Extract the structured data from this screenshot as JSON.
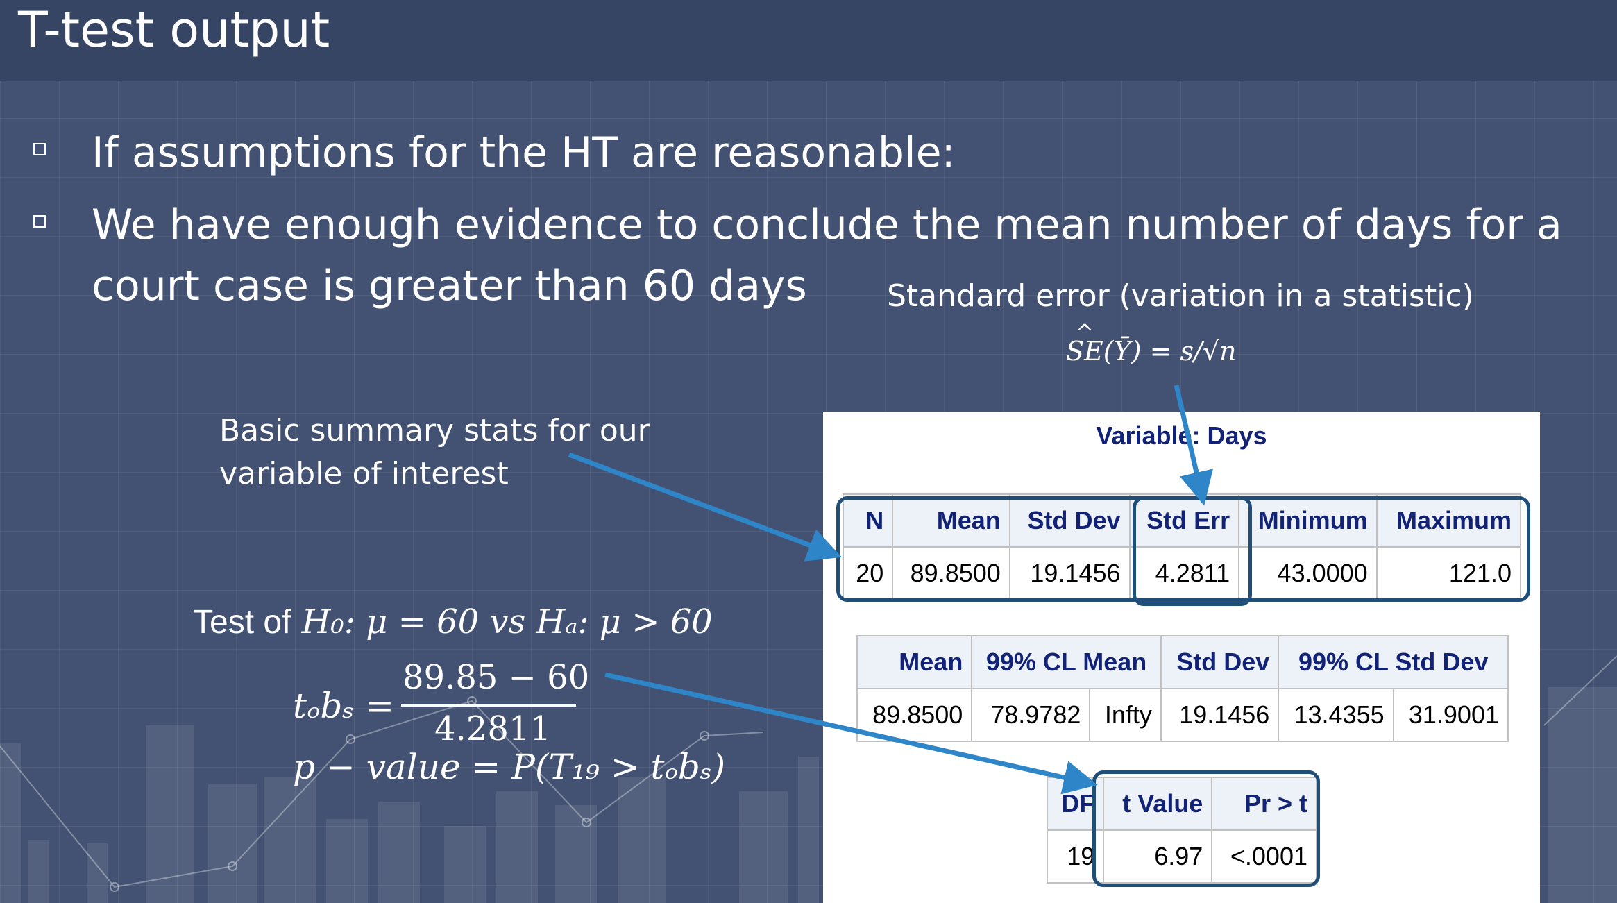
{
  "slide": {
    "title": "T-test output",
    "bullets": [
      "If assumptions for the HT are reasonable:",
      "We have enough evidence to conclude the mean number of days for a court case is greater than 60 days"
    ]
  },
  "annotations": {
    "stderr_label": "Standard error (variation in a statistic)",
    "stderr_formula_lhs": "SE",
    "stderr_formula_rest": "(Ȳ) = s/√n",
    "summary_label_line1": "Basic summary stats for our",
    "summary_label_line2": "variable of interest",
    "test_prefix": "Test of",
    "test_hypothesis": "H₀: μ = 60 vs Hₐ: μ > 60",
    "tobs_lhs": "tₒbₛ =",
    "tobs_numerator": "89.85 − 60",
    "tobs_denominator": "4.2811",
    "pvalue_formula": "p − value = P(T₁₉ > tₒbₛ)"
  },
  "sas_output": {
    "variable_title": "Variable: Days",
    "summary_table": {
      "headers": [
        "N",
        "Mean",
        "Std Dev",
        "Std Err",
        "Minimum",
        "Maximum"
      ],
      "row": [
        "20",
        "89.8500",
        "19.1456",
        "4.2811",
        "43.0000",
        "121.0"
      ]
    },
    "ci_table": {
      "headers": [
        "Mean",
        "99% CL Mean",
        "Std Dev",
        "99% CL Std Dev"
      ],
      "row": [
        "89.8500",
        "78.9782",
        "Infty",
        "19.1456",
        "13.4355",
        "31.9001"
      ]
    },
    "ttest_table": {
      "headers": [
        "DF",
        "t Value",
        "Pr > t"
      ],
      "row": [
        "19",
        "6.97",
        "<.0001"
      ]
    }
  },
  "colors": {
    "background": "#435272",
    "title_bar": "#354563",
    "arrow": "#2e86c8",
    "highlight_box": "#1f4e79",
    "sas_header_text": "#112277"
  },
  "icons": [
    "bullet-square-icon",
    "arrow-icon"
  ]
}
